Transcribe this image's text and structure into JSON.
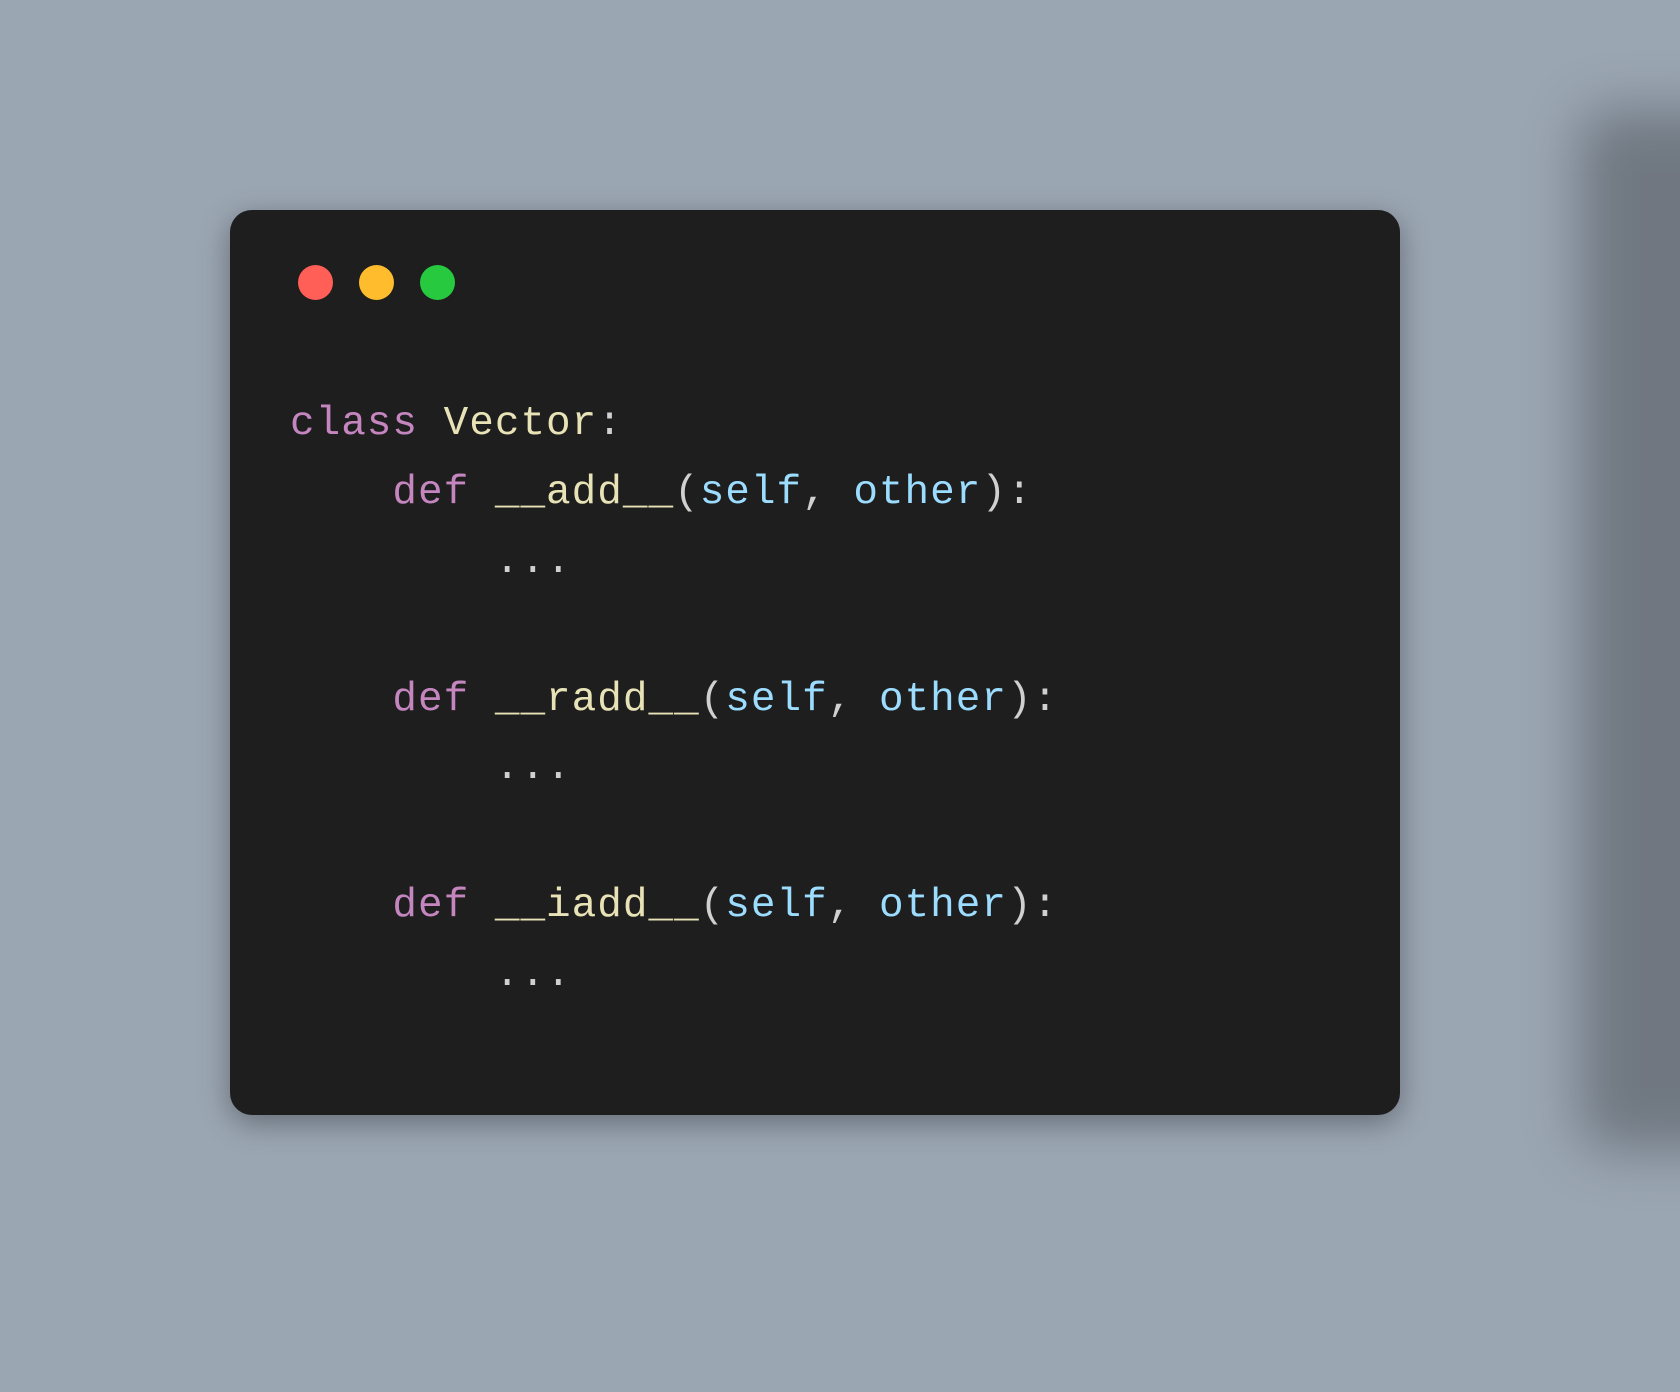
{
  "colors": {
    "background": "#9ba6b3",
    "window": "#1e1e1e",
    "keyword": "#c586c0",
    "identifier": "#e8e2b7",
    "param": "#9cdcfe",
    "punct": "#d0d0d0",
    "traffic_red": "#ff5f56",
    "traffic_yellow": "#ffbd2e",
    "traffic_green": "#27c93f"
  },
  "code": {
    "class_keyword": "class",
    "class_name": "Vector",
    "colon": ":",
    "def_keyword": "def",
    "methods": [
      {
        "name": "__add__",
        "params": [
          "self",
          "other"
        ],
        "body": "..."
      },
      {
        "name": "__radd__",
        "params": [
          "self",
          "other"
        ],
        "body": "..."
      },
      {
        "name": "__iadd__",
        "params": [
          "self",
          "other"
        ],
        "body": "..."
      }
    ],
    "paren_open": "(",
    "paren_close": ")",
    "comma_sep": ", "
  }
}
